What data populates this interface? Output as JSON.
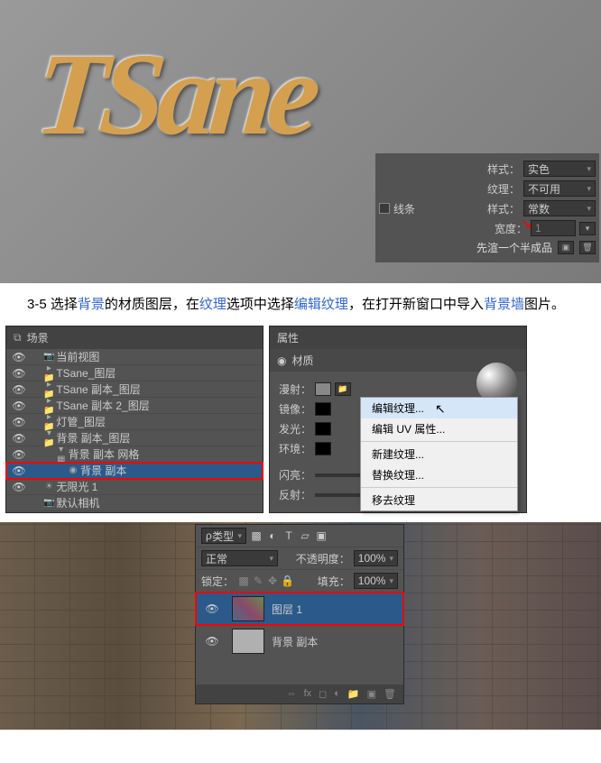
{
  "render": {
    "text_3d": "TSane",
    "annotation": "先渲一个半成品"
  },
  "style_panel": {
    "style_label": "样式：",
    "style_value": "实色",
    "texture_label": "纹理：",
    "texture_value": "不可用",
    "stroke_label": "线条",
    "stroke_style_label": "样式：",
    "stroke_style_value": "常数",
    "width_label": "宽度：",
    "width_value": "1"
  },
  "instruction": {
    "prefix": "3-5 选择",
    "link1": "背景",
    "mid1": "的材质图层，在",
    "link2": "纹理",
    "mid2": "选项中选择",
    "link3": "编辑纹理",
    "mid3": "，在打开新窗口中导入",
    "link4": "背景墙",
    "suffix": "图片。"
  },
  "layers_header": "场景",
  "layers": [
    {
      "eye": true,
      "indent": 2,
      "icon": "📷",
      "name": "当前视图"
    },
    {
      "eye": true,
      "indent": 2,
      "icon": "▸📁",
      "name": "TSane_图层"
    },
    {
      "eye": true,
      "indent": 2,
      "icon": "▸📁",
      "name": "TSane 副本_图层"
    },
    {
      "eye": true,
      "indent": 2,
      "icon": "▸📁",
      "name": "TSane 副本 2_图层"
    },
    {
      "eye": true,
      "indent": 2,
      "icon": "▸📁",
      "name": "灯管_图层"
    },
    {
      "eye": true,
      "indent": 2,
      "icon": "▾📁",
      "name": "背景 副本_图层"
    },
    {
      "eye": true,
      "indent": 4,
      "icon": "▾ ▦",
      "name": "背景 副本 网格"
    },
    {
      "eye": true,
      "indent": 6,
      "icon": "◉",
      "name": "背景 副本",
      "selected": true,
      "red": true
    },
    {
      "eye": true,
      "indent": 2,
      "icon": "☀",
      "name": "无限光 1"
    },
    {
      "eye": false,
      "indent": 2,
      "icon": "📷",
      "name": "默认相机"
    }
  ],
  "props_header": "属性",
  "props_sub": "材质",
  "props": {
    "diffuse": "漫射：",
    "specular": "镜像：",
    "glow": "发光：",
    "ambient": "环境：",
    "shine": "闪亮：",
    "reflect": "反射："
  },
  "context_menu": [
    "编辑纹理...",
    "编辑 UV 属性...",
    "新建纹理...",
    "替换纹理...",
    "移去纹理"
  ],
  "palette": {
    "type_label": "类型",
    "blend_mode": "正常",
    "opacity_label": "不透明度：",
    "opacity_value": "100%",
    "lock_label": "锁定：",
    "fill_label": "填充：",
    "fill_value": "100%",
    "layer1": "图层 1",
    "layer2": "背景 副本"
  }
}
